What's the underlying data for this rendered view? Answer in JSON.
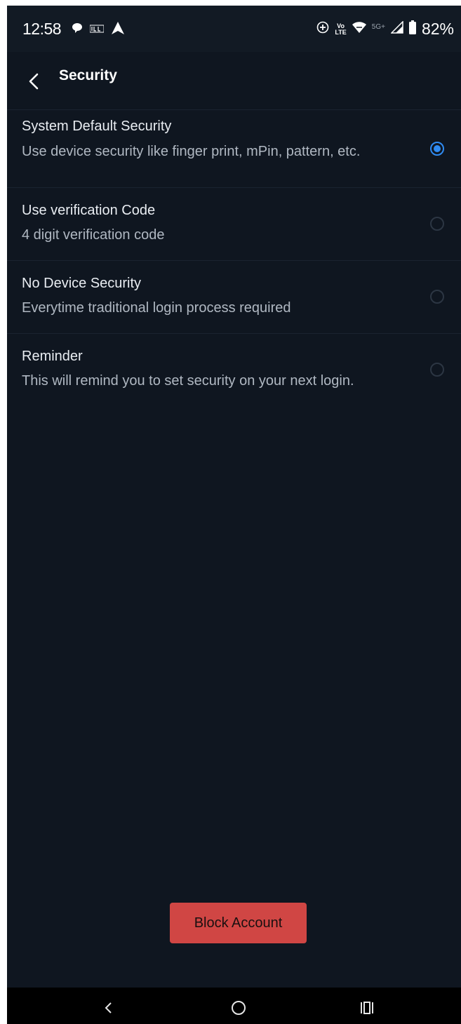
{
  "status_bar": {
    "time": "12:58",
    "battery": "82%",
    "network_5g": "5G+",
    "volte_top": "Vo",
    "volte_bottom": "LTE",
    "icons": [
      "chat-bubble-icon",
      "ipl-icon",
      "navigation-arrow-icon",
      "data-saver-icon",
      "volte-icon",
      "wifi-icon",
      "signal-icon",
      "battery-icon"
    ]
  },
  "header": {
    "title": "Security",
    "back_icon": "chevron-left-icon"
  },
  "options": [
    {
      "title": "System Default Security",
      "description": "Use device security like finger print, mPin, pattern, etc.",
      "selected": true
    },
    {
      "title": "Use verification Code",
      "description": "4 digit verification code",
      "selected": false
    },
    {
      "title": "No Device Security",
      "description": "Everytime traditional login process required",
      "selected": false
    },
    {
      "title": "Reminder",
      "description": "This will remind you to set security on your next login.",
      "selected": false
    }
  ],
  "actions": {
    "block_account": "Block Account"
  },
  "nav_bar": {
    "items": [
      "back-nav-icon",
      "home-nav-icon",
      "recents-nav-icon"
    ]
  },
  "colors": {
    "background": "#0f1620",
    "accent": "#2f8bf2",
    "danger": "#d04644"
  }
}
